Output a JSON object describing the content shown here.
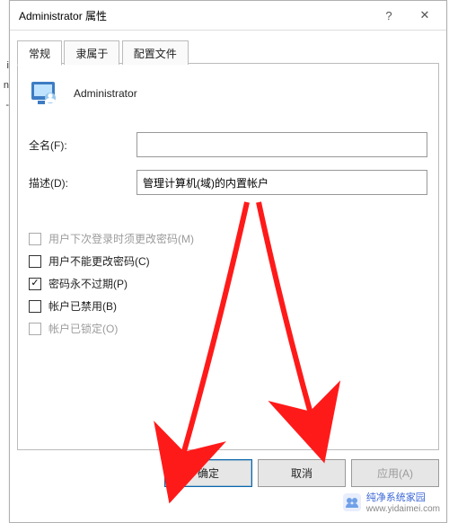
{
  "window": {
    "title": "Administrator 属性",
    "help_glyph": "?",
    "close_glyph": "✕"
  },
  "tabs": [
    {
      "label": "常规",
      "active": true
    },
    {
      "label": "隶属于",
      "active": false
    },
    {
      "label": "配置文件",
      "active": false
    }
  ],
  "user": {
    "name": "Administrator"
  },
  "fields": {
    "fullname_label": "全名(F):",
    "fullname_value": "",
    "description_label": "描述(D):",
    "description_value": "管理计算机(域)的内置帐户"
  },
  "checkboxes": [
    {
      "id": "must-change",
      "label": "用户下次登录时须更改密码(M)",
      "checked": false,
      "disabled": true
    },
    {
      "id": "cannot-change",
      "label": "用户不能更改密码(C)",
      "checked": false,
      "disabled": false
    },
    {
      "id": "never-expire",
      "label": "密码永不过期(P)",
      "checked": true,
      "disabled": false
    },
    {
      "id": "disabled-account",
      "label": "帐户已禁用(B)",
      "checked": false,
      "disabled": false
    },
    {
      "id": "locked-out",
      "label": "帐户已锁定(O)",
      "checked": false,
      "disabled": true
    }
  ],
  "buttons": {
    "ok": "确定",
    "cancel": "取消",
    "apply": "应用(A)"
  },
  "watermark": {
    "name": "纯净系统家园",
    "url": "www.yidaimei.com"
  },
  "bg_fragments": [
    "i",
    "n",
    "-"
  ]
}
